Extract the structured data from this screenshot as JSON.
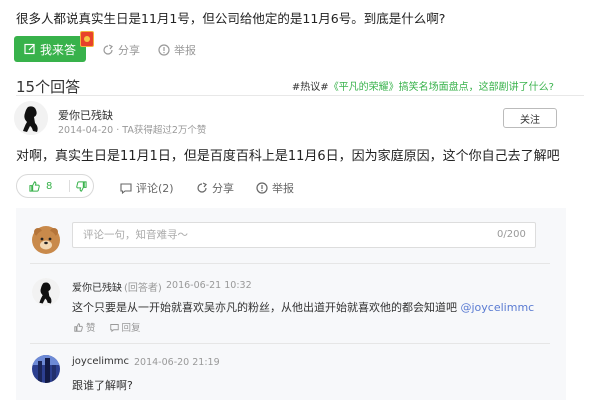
{
  "question": {
    "title": "很多人都说真实生日是11月1号，但公司给他定的是11月6号。到底是什么啊?",
    "answer_button": "我来答",
    "share": "分享",
    "report": "举报"
  },
  "answers_header": {
    "count": "15个回答",
    "hot_tag": "#热议#",
    "hot_link": "《平凡的荣耀》搞笑名场面盘点，这部剧讲了什么?"
  },
  "answer": {
    "author": "爱你已残缺",
    "meta": "2014-04-20 · TA获得超过2万个赞",
    "follow": "关注",
    "text": "对啊，真实生日是11月1日，但是百度百科上是11月6日，因为家庭原因，这个你自己去了解吧",
    "likes": "8",
    "comment": "评论(2)",
    "share": "分享",
    "report": "举报"
  },
  "comment_box": {
    "placeholder": "评论一句，知音难寻～",
    "counter": "0/200"
  },
  "comments": [
    {
      "name": "爱你已残缺",
      "role": "(回答者)",
      "time": "2016-06-21 10:32",
      "text": "这个只要是从一开始就喜欢吴亦凡的粉丝，从他出道开始就喜欢他的都会知道吧",
      "mention": "@joycelimmc",
      "like": "赞",
      "reply": "回复"
    },
    {
      "name": "joycelimmc",
      "time": "2014-06-20 21:19",
      "text": "跟谁了解啊?"
    }
  ],
  "colors": {
    "accent": "#38b24b",
    "link": "#5a7bd2"
  }
}
